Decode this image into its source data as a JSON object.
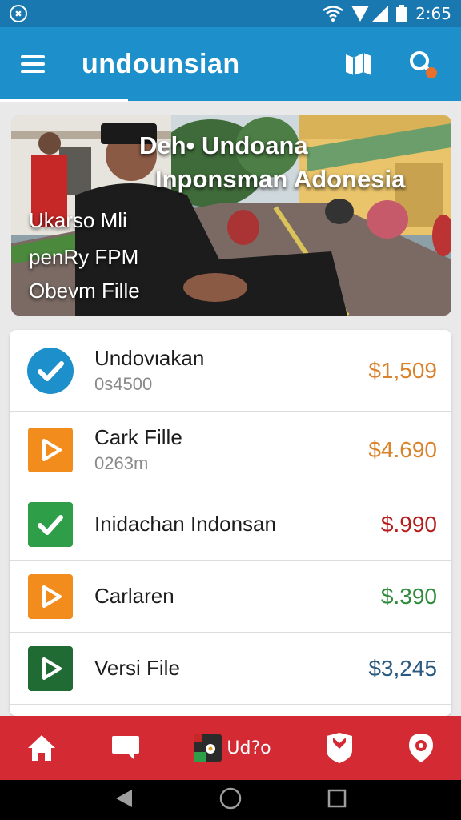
{
  "status_bar": {
    "time": "2:65",
    "left_icon": "compass-badge-icon",
    "icons": [
      "wifi-icon",
      "signal-icon",
      "battery-icon"
    ]
  },
  "app_bar": {
    "title": "undounsian",
    "menu_icon": "hamburger-menu-icon",
    "actions": [
      "map-icon",
      "search-icon"
    ],
    "search_badge_color": "#e8702a"
  },
  "hero": {
    "headline_line1": "Deh• Undoana",
    "headline_line2": "Inponsman  Adonesia",
    "caption_line1": "Ukarso Mli",
    "caption_line2": "penRy FPM",
    "caption_line3": "Obevm Fille"
  },
  "list": {
    "items": [
      {
        "name": "Undovιakan",
        "sub": "0s4500",
        "amount": "$1,509",
        "amount_color": "#d9822b",
        "icon": "check-circle-icon",
        "icon_color": "#1d8fcb"
      },
      {
        "name": "Cark Fille",
        "sub": "0263m",
        "amount": "$4.690",
        "amount_color": "#d9822b",
        "icon": "play-file-icon",
        "icon_color": "#f28c1c"
      },
      {
        "name": "Inidachan Indonsan",
        "sub": "",
        "amount": "$.990",
        "amount_color": "#b71c1c",
        "icon": "check-square-icon",
        "icon_color": "#2e9e48"
      },
      {
        "name": "Carlaren",
        "sub": "",
        "amount": "$.390",
        "amount_color": "#2e8b3a",
        "icon": "play-file-icon",
        "icon_color": "#f28c1c"
      },
      {
        "name": "Versi File",
        "sub": "",
        "amount": "$3,245",
        "amount_color": "#2a5a80",
        "icon": "play-file-icon",
        "icon_color": "#1f6b33"
      }
    ]
  },
  "bottom_nav": {
    "items": [
      {
        "icon": "home-icon"
      },
      {
        "icon": "chat-icon"
      },
      {
        "icon": "photo-flower-icon",
        "label": "Ud?o"
      },
      {
        "icon": "shield-heart-icon"
      },
      {
        "icon": "location-pin-icon"
      }
    ]
  },
  "system_nav": [
    "back-icon",
    "home-circle-icon",
    "recents-icon"
  ]
}
